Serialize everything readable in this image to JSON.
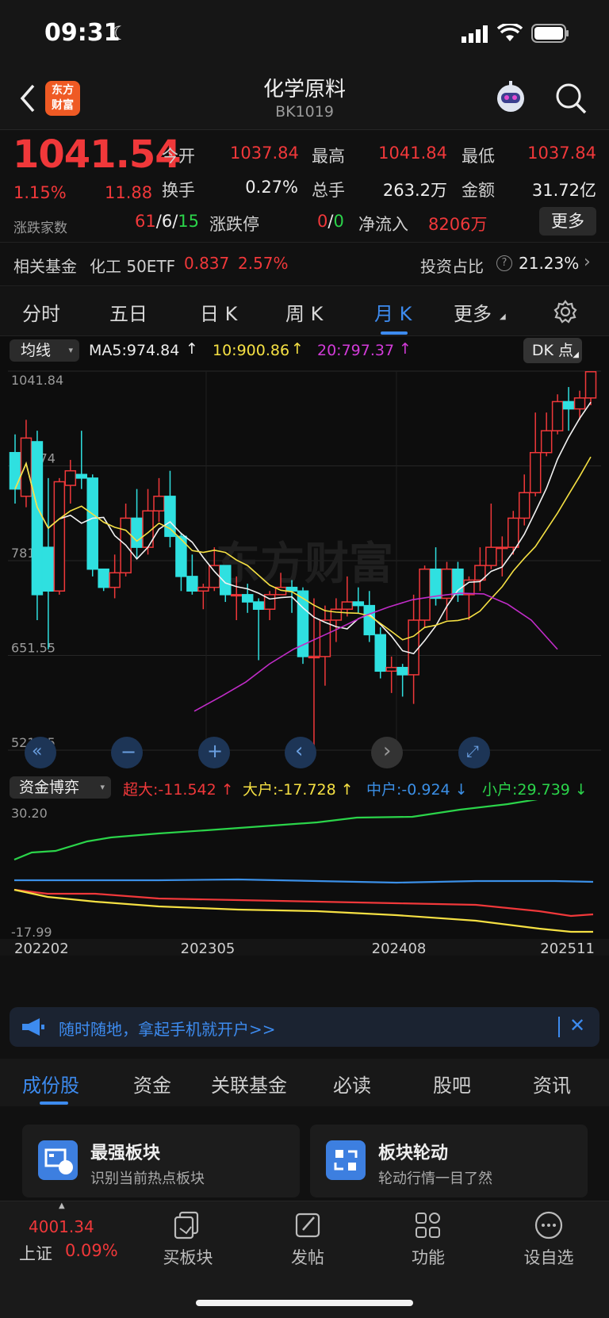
{
  "status": {
    "time": "09:31"
  },
  "nav": {
    "title": "化学原料",
    "code": "BK1019",
    "logo_line1": "东方",
    "logo_line2": "财富"
  },
  "quote": {
    "price": "1041.54",
    "change_pct": "1.15%",
    "change": "11.88",
    "open_label": "今开",
    "open": "1037.84",
    "high_label": "最高",
    "high": "1041.84",
    "low_label": "最低",
    "low": "1037.84",
    "turnover_label": "换手",
    "turnover": "0.27%",
    "volume_label": "总手",
    "volume": "263.2万",
    "amount_label": "金额",
    "amount": "31.72亿",
    "updown_label": "涨跌家数",
    "up": "61",
    "flat": "6",
    "down": "15",
    "limit_label": "涨跌停",
    "limit_up": "0",
    "limit_down": "0",
    "netflow_label": "净流入",
    "netflow": "8206万",
    "more_label": "更多"
  },
  "fund": {
    "label": "相关基金",
    "name": "化工 50ETF",
    "price": "0.837",
    "pct": "2.57%",
    "ratio_label": "投资占比",
    "ratio": "21.23%"
  },
  "tabs": [
    "分时",
    "五日",
    "日 K",
    "周 K",
    "月 K",
    "更多"
  ],
  "chart": {
    "indicator": "均线",
    "ma5": "MA5:974.84",
    "ma10": "10:900.86",
    "ma20": "20:797.37",
    "dk_label": "DK 点",
    "y_ticks": [
      "1041.84",
      "911.74",
      "781.65",
      "651.55",
      "521.45"
    ],
    "watermark": "东方财富",
    "colors": {
      "up": "#f0383a",
      "down": "#2fe0e0",
      "ma5": "#f2f2f2",
      "ma10": "#f5e043",
      "ma20": "#c12cc8"
    }
  },
  "chart_data": {
    "type": "candlestick",
    "ylim": [
      521.45,
      1041.84
    ],
    "candles": [
      [
        930,
        880,
        955,
        860
      ],
      [
        870,
        950,
        975,
        855
      ],
      [
        945,
        735,
        960,
        700
      ],
      [
        800,
        740,
        895,
        660
      ],
      [
        740,
        890,
        895,
        735
      ],
      [
        885,
        905,
        920,
        860
      ],
      [
        900,
        895,
        960,
        880
      ],
      [
        895,
        770,
        900,
        760
      ],
      [
        770,
        745,
        770,
        740
      ],
      [
        745,
        765,
        790,
        730
      ],
      [
        765,
        840,
        860,
        760
      ],
      [
        840,
        800,
        880,
        785
      ],
      [
        800,
        850,
        880,
        790
      ],
      [
        850,
        870,
        895,
        835
      ],
      [
        870,
        815,
        905,
        800
      ],
      [
        815,
        760,
        820,
        740
      ],
      [
        760,
        740,
        790,
        735
      ],
      [
        740,
        745,
        750,
        715
      ],
      [
        745,
        775,
        800,
        740
      ],
      [
        775,
        735,
        775,
        725
      ],
      [
        735,
        735,
        760,
        700
      ],
      [
        735,
        725,
        750,
        710
      ],
      [
        725,
        715,
        730,
        645
      ],
      [
        715,
        735,
        740,
        700
      ],
      [
        735,
        745,
        765,
        735
      ],
      [
        745,
        740,
        755,
        710
      ],
      [
        740,
        650,
        745,
        640
      ],
      [
        650,
        650,
        730,
        525
      ],
      [
        650,
        700,
        720,
        610
      ],
      [
        700,
        715,
        730,
        670
      ],
      [
        715,
        725,
        760,
        705
      ],
      [
        725,
        720,
        745,
        710
      ],
      [
        720,
        680,
        740,
        670
      ],
      [
        680,
        630,
        690,
        620
      ],
      [
        630,
        635,
        650,
        600
      ],
      [
        635,
        625,
        640,
        595
      ],
      [
        625,
        700,
        735,
        585
      ],
      [
        700,
        770,
        775,
        690
      ],
      [
        770,
        730,
        800,
        720
      ],
      [
        730,
        770,
        780,
        700
      ],
      [
        770,
        735,
        780,
        725
      ],
      [
        735,
        755,
        760,
        700
      ],
      [
        755,
        775,
        800,
        740
      ],
      [
        775,
        800,
        860,
        770
      ],
      [
        800,
        800,
        815,
        760
      ],
      [
        800,
        840,
        850,
        790
      ],
      [
        840,
        875,
        900,
        830
      ],
      [
        875,
        930,
        985,
        870
      ],
      [
        930,
        960,
        985,
        925
      ],
      [
        960,
        1000,
        1010,
        955
      ],
      [
        1000,
        990,
        1020,
        960
      ],
      [
        990,
        1005,
        1015,
        975
      ],
      [
        1005,
        1041,
        1041,
        995
      ]
    ],
    "ma20": [
      [
        245,
        575
      ],
      [
        280,
        596
      ],
      [
        310,
        615
      ],
      [
        340,
        640
      ],
      [
        370,
        660
      ],
      [
        400,
        675
      ],
      [
        430,
        690
      ],
      [
        460,
        706
      ],
      [
        490,
        718
      ],
      [
        520,
        728
      ],
      [
        550,
        733
      ],
      [
        580,
        737
      ],
      [
        610,
        736
      ],
      [
        640,
        722
      ],
      [
        670,
        700
      ],
      [
        703,
        660
      ]
    ]
  },
  "flow": {
    "indicator": "资金博弈",
    "super_large": "超大:-11.542",
    "large": "大户:-17.728",
    "medium": "中户:-0.924",
    "small": "小户:29.739",
    "y_top": "30.20",
    "y_bottom": "-17.99",
    "x_labels": [
      "202202",
      "202305",
      "202408",
      "202511"
    ]
  },
  "banner": {
    "text": "随时随地，拿起手机就开户>>"
  },
  "subtabs": [
    "成份股",
    "资金",
    "关联基金",
    "必读",
    "股吧",
    "资讯"
  ],
  "cards": [
    {
      "title": "最强板块",
      "desc": "识别当前热点板块"
    },
    {
      "title": "板块轮动",
      "desc": "轮动行情一目了然"
    }
  ],
  "bottom": {
    "index_value": "4001.34",
    "index_name": "上证",
    "index_pct": "0.09%",
    "items": [
      "买板块",
      "发帖",
      "功能",
      "设自选"
    ]
  }
}
